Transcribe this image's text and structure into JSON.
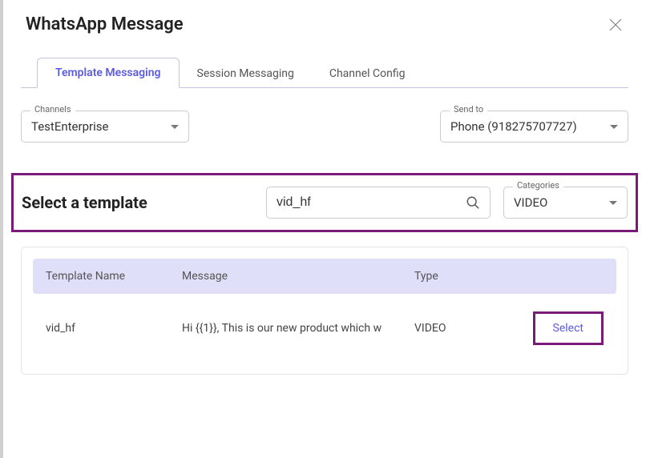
{
  "header": {
    "title": "WhatsApp Message"
  },
  "tabs": {
    "template": "Template Messaging",
    "session": "Session Messaging",
    "channel": "Channel Config"
  },
  "fields": {
    "channels_label": "Channels",
    "channels_value": "TestEnterprise",
    "sendto_label": "Send to",
    "sendto_value": "Phone (918275707727)",
    "categories_label": "Categories",
    "categories_value": "VIDEO"
  },
  "template_section": {
    "heading": "Select a template",
    "search_value": "vid_hf"
  },
  "table": {
    "headers": {
      "name": "Template Name",
      "message": "Message",
      "type": "Type"
    },
    "row": {
      "name": "vid_hf",
      "message": "Hi {{1}}, This is our new product which w",
      "type": "VIDEO",
      "action": "Select"
    }
  }
}
